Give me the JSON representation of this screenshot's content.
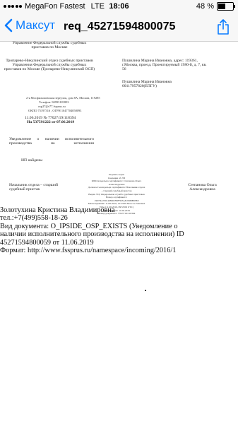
{
  "status_bar": {
    "carrier": "MegaFon Fastest",
    "network": "LTE",
    "time": "18:06",
    "battery_text": "48 %",
    "battery_level": 0.48
  },
  "nav": {
    "back_label": "Максут",
    "title": "req_45271594800075"
  },
  "doc": {
    "header_left": "Управление Федеральной службы судебных приставов по Москве",
    "dept_left": "Тропарево-Никулинский отдел судебных приставов Управления Федеральной службы судебных приставов по Москве (Тропарево-Никулинский ОСП)",
    "debtor1": "Пушилина Марина Ивановна, адрес: 119361, г.Москва, проезд. Проектируемый 1980-й, д. 7, кв. 56",
    "debtor2": "Пушилина Марина Ивановна 00117957820(ЕПГУ)",
    "address_small": "2-я Мосфильмовская переулок, дом 8А, Москва, 119285",
    "phone_small": "Телефон: 84993181803",
    "email_small": "osp27@r77.fssprus.ru",
    "okpo_small": "ОКПО 75197316 , ОГРН 1047704058093",
    "doc_number_line": "11.06.2019 № 77027/19/118394",
    "doc_ref_line": "На 537591222 от 07.06.2019",
    "notice_title": "Уведомление о наличии исполнительного производства на исполнении",
    "ip_found": "ИП найдены",
    "chief_title": "Начальник отдела – старший судебный пристав",
    "signature_lines": [
      "Подпись верна",
      "Сведения об ЭП",
      "ФИО владельца сертификата: Степанова Ольга",
      "Александровна",
      "Должность владельца сертификата: Начальник отдела",
      "- старший судебный пристав",
      "Выдан УЦ: Федеральная служба судебных приставов",
      "Номер сертификата:",
      "1997DA7DC408DCB8F7D3AE250BB95E8",
      "Метка времени: 11.06.2019, 12:53:09 Moscow Standard",
      "Time (11.06.2019, 09:53:09 UTC)",
      "Дата подписи: 11.06.2019",
      "Номер документа: 77027/19/118394"
    ],
    "chief_name": "Степанова Ольга Александровна",
    "footer_lines": [
      "Золотухина Кристина Владимировна",
      "тел.:+7(499)558-18-26",
      "Вид документа: O_IPSIDE_OSP_EXISTS (Уведомление о",
      "наличии исполнительного производства на исполнении) ID",
      "45271594800059 от 11.06.2019",
      "Формат: http://www.fssprus.ru/namespace/incoming/2016/1"
    ]
  }
}
